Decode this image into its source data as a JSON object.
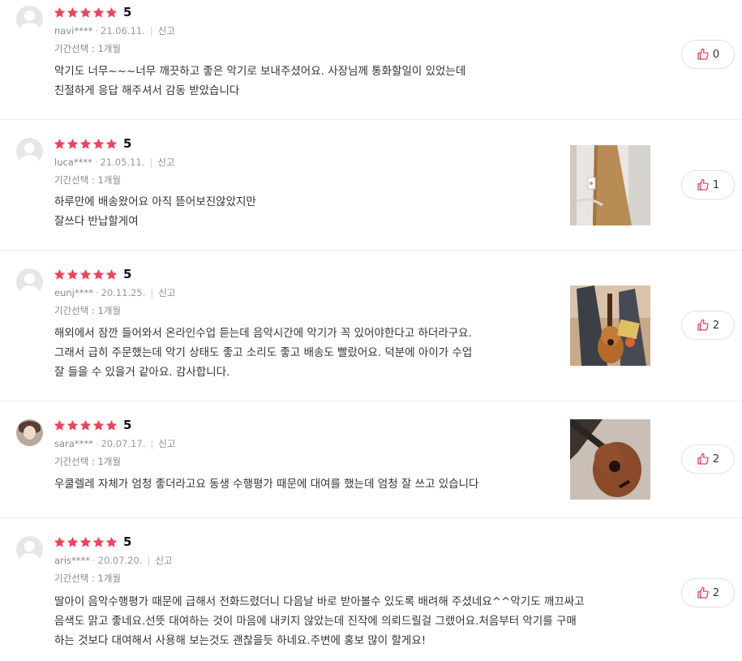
{
  "colors": {
    "star": "#f2435a",
    "like_icon": "#f2435a"
  },
  "reviews": [
    {
      "user": "navi****",
      "date": "21.06.11.",
      "report": "신고",
      "score": "5",
      "option": "기간선택 : 1개월",
      "lines": [
        "악기도 너무~~~너무 깨끗하고 좋은 악기로 보내주셨어요. 사장님께 통화할일이 있었는데",
        "친절하게 응답 해주셔서 감동 받았습니다"
      ],
      "likes": "0",
      "avatar": "default-avatar",
      "image": null
    },
    {
      "user": "luca****",
      "date": "21.05.11.",
      "report": "신고",
      "score": "5",
      "option": "기간선택 : 1개월",
      "lines": [
        "하루만에 배송왔어요 아직 뜯어보진않았지만",
        "잘쓰다 반납할게여"
      ],
      "likes": "1",
      "avatar": "default-avatar",
      "image": "boxed-instrument-photo"
    },
    {
      "user": "eunj****",
      "date": "20.11.25.",
      "report": "신고",
      "score": "5",
      "option": "기간선택 : 1개월",
      "lines": [
        "해외에서 잠깐 들어와서 온라인수업 듣는데 음악시간에 악기가 꼭 있어야한다고 하더라구요.",
        "그래서 급히 주문했는데 악기 상태도 좋고 소리도 좋고 배송도 빨랐어요. 덕분에 아이가 수업",
        "잘 들을 수 있을거 같아요. 감사합니다."
      ],
      "likes": "2",
      "avatar": "default-avatar",
      "image": "ukulele-with-bag-photo"
    },
    {
      "user": "sara****",
      "date": "20.07.17.",
      "report": "신고",
      "score": "5",
      "option": "기간선택 : 1개월",
      "lines": [
        "우쿨렐레 자체가 엄청 좋더라고요 동생 수행평가 때문에 대여를 했는데 엄청 잘 쓰고 있습니다"
      ],
      "likes": "2",
      "avatar": "profile-photo",
      "image": "ukulele-photo"
    },
    {
      "user": "aris****",
      "date": "20.07.20.",
      "report": "신고",
      "score": "5",
      "option": "기간선택 : 1개월",
      "lines": [
        "딸아이 음악수행평가 때문에 급해서 전화드렸더니 다음날 바로 받아볼수 있도록 배려해 주셨네요^^악기도 깨끄싸고",
        "음색도 맑고 좋네요.선뜻 대여하는 것이 마음에 내키지 않았는데 진작에 의뢰드릴걸 그랬어요.처음부터 악기를 구매",
        "하는 것보다 대여해서 사용해 보는것도 괜찮을듯 하네요.주변에 홍보 많이 할게요!"
      ],
      "likes": "2",
      "avatar": "default-avatar",
      "image": null
    }
  ]
}
